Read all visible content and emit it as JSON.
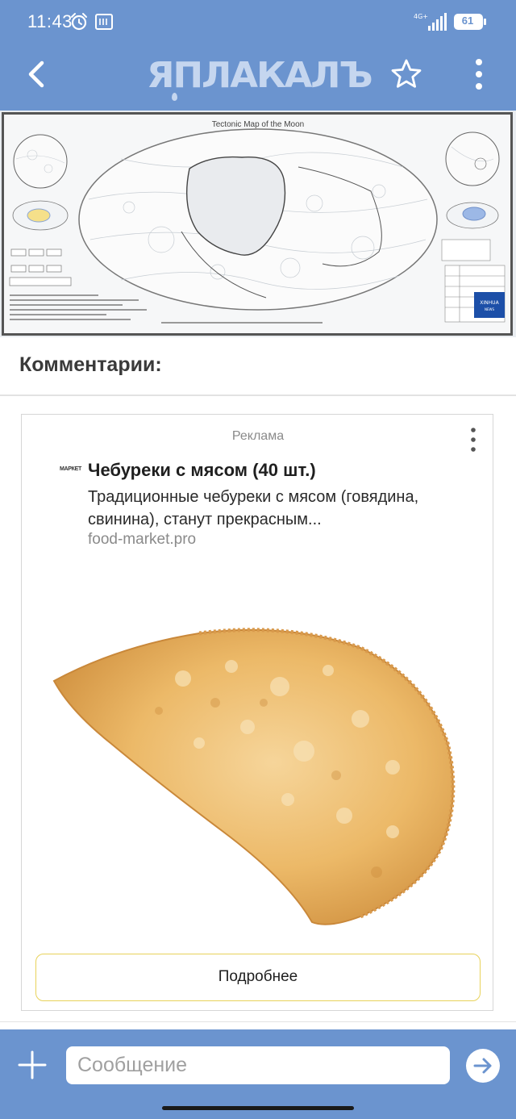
{
  "status_bar": {
    "time": "11:43",
    "network": "4G+",
    "battery": "61"
  },
  "header": {
    "logo": "ЯПЛАКАЛЪ",
    "back_icon": "chevron-left-icon",
    "favorite_icon": "star-outline-icon",
    "menu_icon": "kebab-menu-icon"
  },
  "post": {
    "image_title": "Tectonic Map of the Moon"
  },
  "comments": {
    "title": "Комментарии:"
  },
  "ad": {
    "label": "Реклама",
    "favicon_text": "МАРКЕТ",
    "title": "Чебуреки с мясом (40 шт.)",
    "text": "Традиционные чебуреки с мясом (говядина, свинина), станут прекрасным...",
    "domain": "food-market.pro",
    "button_label": "Подробнее"
  },
  "compose": {
    "placeholder": "Сообщение",
    "value": ""
  },
  "colors": {
    "primary": "#6b94cf",
    "logo": "#c5d6ef",
    "button_border": "#e8d25a"
  }
}
